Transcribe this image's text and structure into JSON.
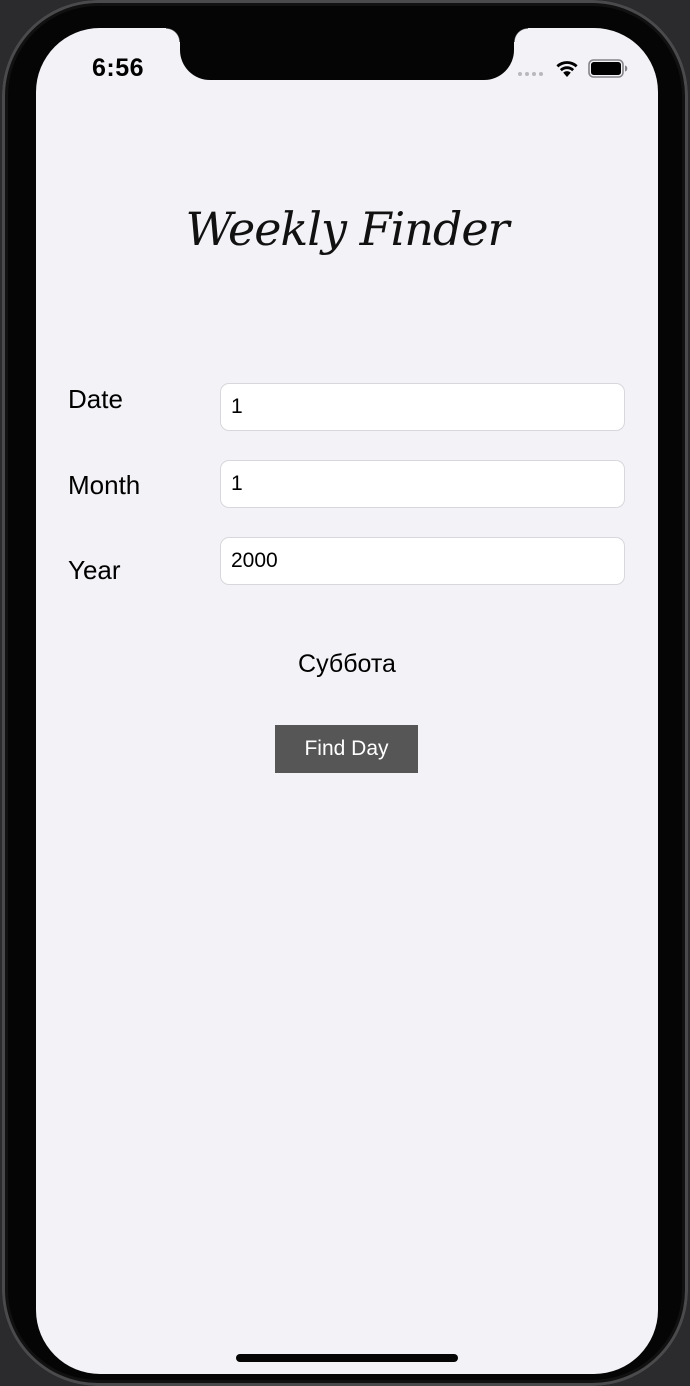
{
  "status_bar": {
    "time": "6:56",
    "icons": [
      "cellular-signal-icon",
      "wifi-icon",
      "battery-icon"
    ]
  },
  "app": {
    "title": "Weekly Finder"
  },
  "form": {
    "date": {
      "label": "Date",
      "value": "1"
    },
    "month": {
      "label": "Month",
      "value": "1"
    },
    "year": {
      "label": "Year",
      "value": "2000"
    }
  },
  "result": {
    "text": "Суббота"
  },
  "actions": {
    "find_label": "Find Day"
  },
  "colors": {
    "background": "#f2f2f7",
    "button": "#565656",
    "button_text": "#ffffff",
    "input_background": "#ffffff"
  }
}
